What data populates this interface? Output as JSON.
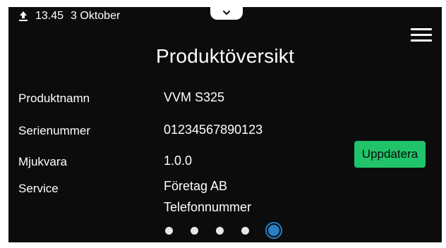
{
  "status_bar": {
    "time": "13.45",
    "date": "3 Oktober",
    "icon": "upload-icon"
  },
  "header": {
    "title": "Produktöversikt",
    "menu_icon": "hamburger-menu-icon"
  },
  "product_info": [
    {
      "label": "Produktnamn",
      "value": "VVM S325"
    },
    {
      "label": "Serienummer",
      "value": "01234567890123"
    },
    {
      "label": "Mjukvara",
      "value": "1.0.0"
    },
    {
      "label": "Service",
      "value": "Företag AB"
    }
  ],
  "service_phone": "Telefonnummer",
  "update_button_label": "Uppdatera",
  "pagination": {
    "total": 5,
    "active_index": 4
  },
  "colors": {
    "background": "#0c0c0c",
    "text": "#ffffff",
    "update_button": "#20c36a",
    "active_dot": "#2a7fc4",
    "inactive_dot": "#e6e6e6"
  }
}
